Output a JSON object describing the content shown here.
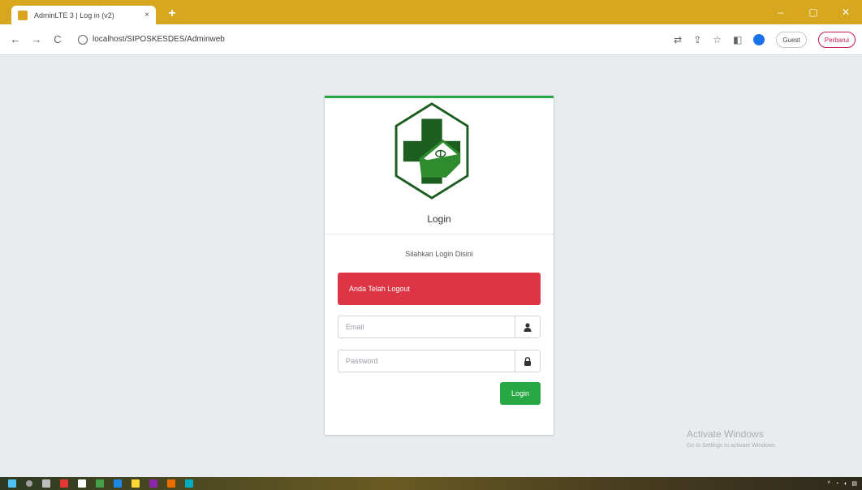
{
  "browser": {
    "tab_title": "AdminLTE 3 | Log in (v2)",
    "tab_close": "×",
    "new_tab": "+",
    "window_controls": [
      "–",
      "▢",
      "✕"
    ],
    "url": "localhost/SIPOSKESDES/Adminweb",
    "guest_label": "Guest",
    "update_label": "Perbarui"
  },
  "login": {
    "header_title": "Login",
    "message": "Silahkan Login Disini",
    "alert": "Anda Telah Logout",
    "email_placeholder": "Email",
    "password_placeholder": "Password",
    "submit_label": "Login"
  },
  "watermark": {
    "title": "Activate Windows",
    "subtitle": "Go to Settings to activate Windows."
  },
  "colors": {
    "accent": "#28a745",
    "alert": "#dc3545",
    "logo_dark": "#1b5e20",
    "logo_light": "#2e8b2e",
    "titlebar": "#d6a71f"
  },
  "icons": [
    "user-icon",
    "lock-icon",
    "search-icon",
    "star-icon",
    "gear-icon",
    "reload-icon"
  ]
}
